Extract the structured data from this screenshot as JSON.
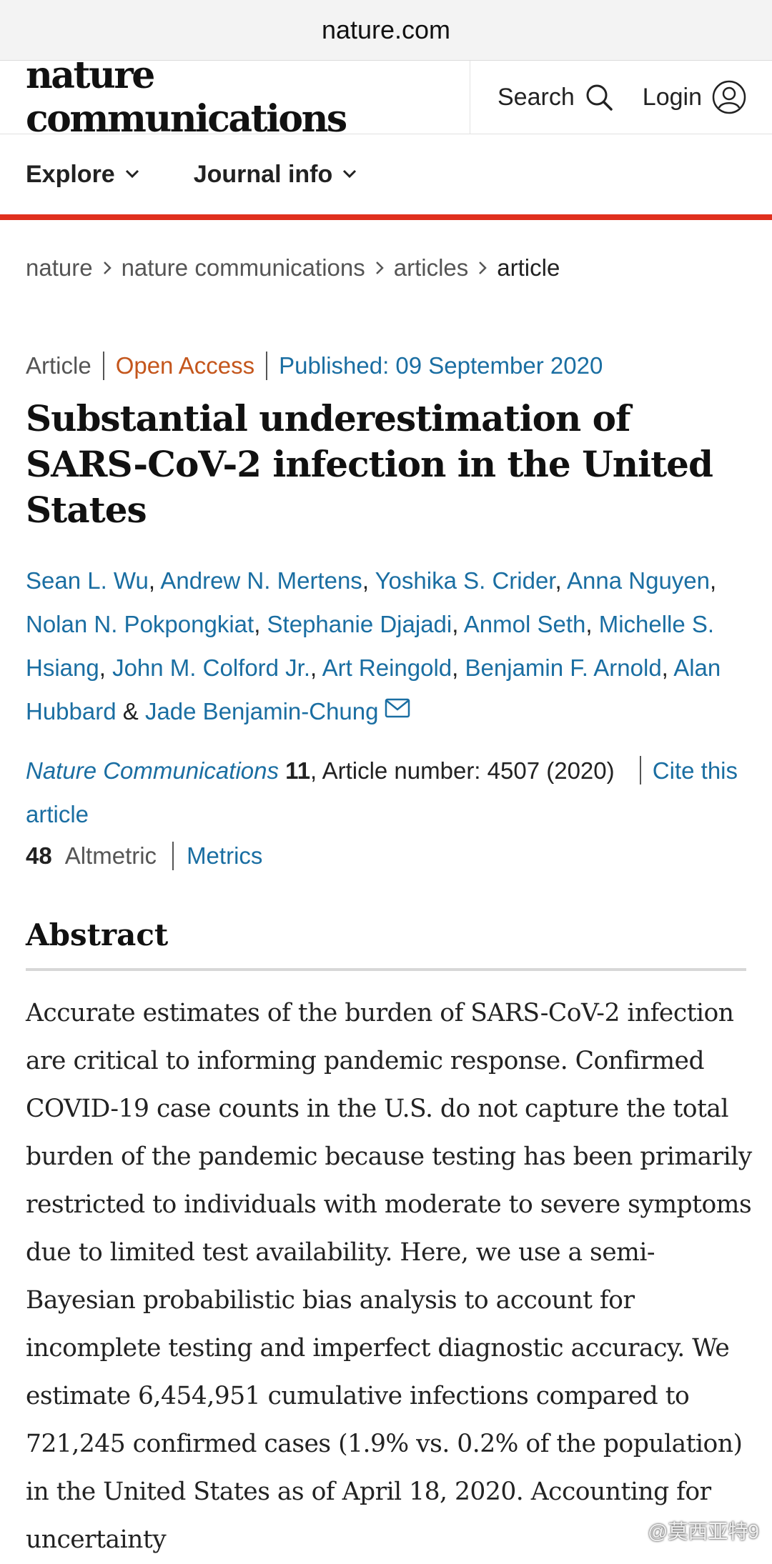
{
  "browser": {
    "url": "nature.com"
  },
  "header": {
    "brand": "nature communications",
    "search_label": "Search",
    "login_label": "Login"
  },
  "nav": {
    "explore": "Explore",
    "journal_info": "Journal info"
  },
  "breadcrumb": [
    "nature",
    "nature communications",
    "articles",
    "article"
  ],
  "article": {
    "type": "Article",
    "access": "Open Access",
    "published": "Published: 09 September 2020",
    "title": "Substantial underestimation of SARS-CoV-2 infection in the United States",
    "authors": [
      "Sean L. Wu",
      "Andrew N. Mertens",
      "Yoshika S. Crider",
      "Anna Nguyen",
      "Nolan N. Pokpongkiat",
      "Stephanie Djajadi",
      "Anmol Seth",
      "Michelle S. Hsiang",
      "John M. Colford Jr.",
      "Art Reingold",
      "Benjamin F. Arnold",
      "Alan Hubbard",
      "Jade Benjamin-Chung"
    ],
    "journal": "Nature Communications",
    "volume": "11",
    "article_number": ", Article number: 4507 (2020)",
    "cite_label": "Cite this article",
    "altmetric_count": "48",
    "altmetric_label": "Altmetric",
    "metrics_label": "Metrics"
  },
  "abstract": {
    "heading": "Abstract",
    "text": "Accurate estimates of the burden of SARS-CoV-2 infection are critical to informing pandemic response. Confirmed COVID-19 case counts in the U.S. do not capture the total burden of the pandemic because testing has been primarily restricted to individuals with moderate to severe symptoms due to limited test availability. Here, we use a semi-Bayesian probabilistic bias analysis to account for incomplete testing and imperfect diagnostic accuracy. We estimate 6,454,951 cumulative infections compared to 721,245 confirmed cases (1.9% vs. 0.2% of the population) in the United States as of April 18, 2020. Accounting for uncertainty"
  },
  "watermark": "@莫西亚特9",
  "colors": {
    "accent_bar": "#e0301e",
    "link": "#1a6ea2",
    "open_access": "#c4561c"
  }
}
